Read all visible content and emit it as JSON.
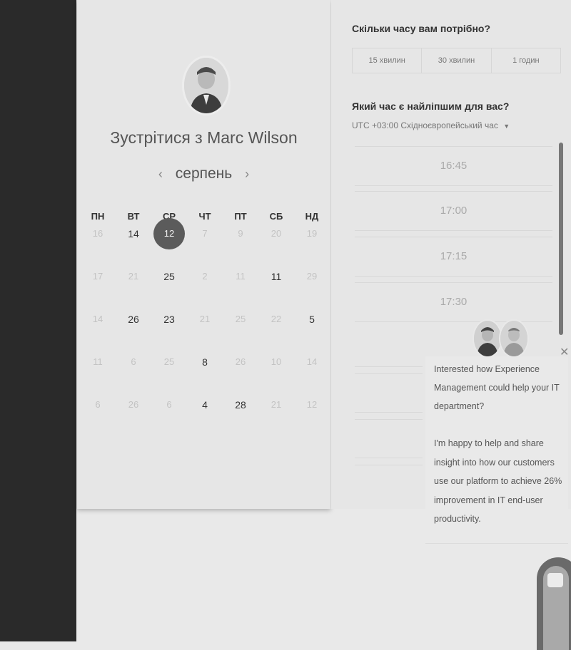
{
  "host": {
    "title_prefix": "Зустрітися з",
    "name": "Marc Wilson",
    "avatar_icon": "person-photo-icon"
  },
  "calendar": {
    "month": "серпень",
    "prev_icon": "‹",
    "next_icon": "›",
    "weekdays": [
      "ПН",
      "ВТ",
      "СР",
      "ЧТ",
      "ПТ",
      "СБ",
      "НД"
    ],
    "weeks": [
      [
        {
          "d": "16",
          "s": "dim"
        },
        {
          "d": "14",
          "s": "active"
        },
        {
          "d": "12",
          "s": "selected"
        },
        {
          "d": "7",
          "s": "dim"
        },
        {
          "d": "9",
          "s": "dim"
        },
        {
          "d": "20",
          "s": "dim"
        },
        {
          "d": "19",
          "s": "dim"
        }
      ],
      [
        {
          "d": "17",
          "s": "dim"
        },
        {
          "d": "21",
          "s": "dim"
        },
        {
          "d": "25",
          "s": "active"
        },
        {
          "d": "2",
          "s": "dim"
        },
        {
          "d": "11",
          "s": "dim"
        },
        {
          "d": "11",
          "s": "active"
        },
        {
          "d": "29",
          "s": "dim"
        }
      ],
      [
        {
          "d": "14",
          "s": "dim"
        },
        {
          "d": "26",
          "s": "active"
        },
        {
          "d": "23",
          "s": "active"
        },
        {
          "d": "21",
          "s": "dim"
        },
        {
          "d": "25",
          "s": "dim"
        },
        {
          "d": "22",
          "s": "dim"
        },
        {
          "d": "5",
          "s": "active"
        }
      ],
      [
        {
          "d": "11",
          "s": "dim"
        },
        {
          "d": "6",
          "s": "dim"
        },
        {
          "d": "25",
          "s": "dim"
        },
        {
          "d": "8",
          "s": "active"
        },
        {
          "d": "26",
          "s": "dim"
        },
        {
          "d": "10",
          "s": "dim"
        },
        {
          "d": "14",
          "s": "dim"
        }
      ],
      [
        {
          "d": "6",
          "s": "dim"
        },
        {
          "d": "26",
          "s": "dim"
        },
        {
          "d": "6",
          "s": "dim"
        },
        {
          "d": "4",
          "s": "active"
        },
        {
          "d": "28",
          "s": "active"
        },
        {
          "d": "21",
          "s": "dim"
        },
        {
          "d": "12",
          "s": "dim"
        }
      ]
    ]
  },
  "duration": {
    "question": "Скільки часу вам потрібно?",
    "options": [
      "15 хвилин",
      "30 хвилин",
      "1 годин"
    ]
  },
  "time": {
    "question": "Який час є найліпшим для вас?",
    "timezone": "UTC +03:00 Східноєвропейський час",
    "slots": [
      "16:45",
      "17:00",
      "17:15",
      "17:30"
    ]
  },
  "chat": {
    "close_icon": "✕",
    "message_lines": [
      "Interested how Experience",
      "Management could help your IT",
      "department?",
      "",
      "I'm happy to help and share",
      "insight into how our customers",
      "use our platform to achieve 26%",
      "improvement in IT end-user",
      "productivity."
    ]
  },
  "colors": {
    "selected_day": "#5b5b5b",
    "sidebar": "#2a2a2a",
    "background": "#e9e9e9"
  }
}
